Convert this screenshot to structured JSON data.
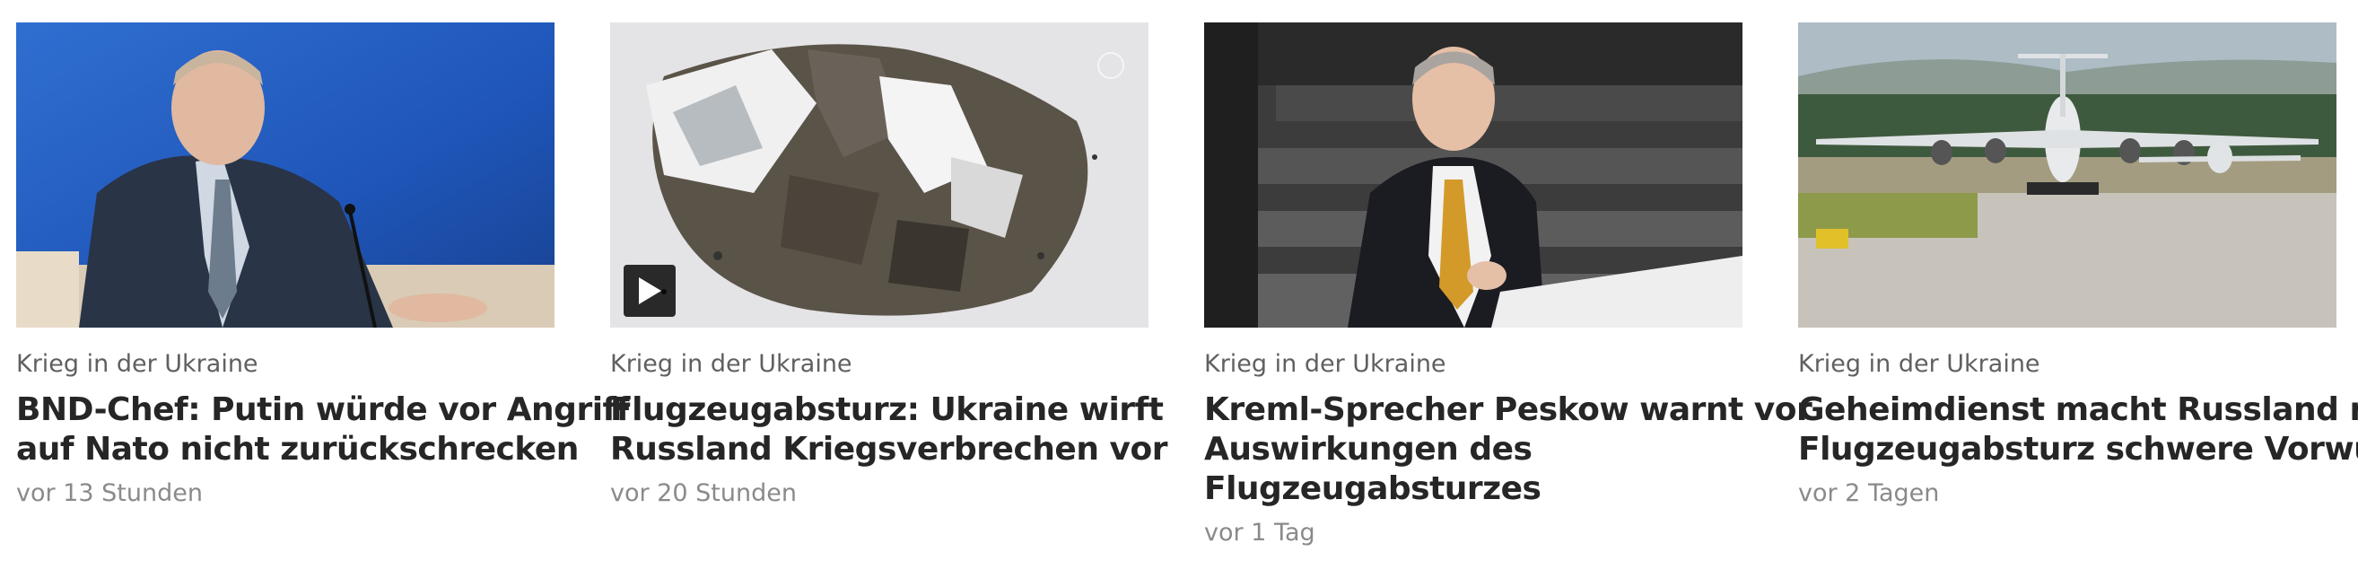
{
  "articles": [
    {
      "kicker": "Krieg in der Ukraine",
      "headline_lines": [
        "BND-Chef: Putin würde vor Angriff",
        "auf Nato nicht zurückschrecken"
      ],
      "timestamp": "vor 13 Stunden",
      "image_icon": "portrait-photo",
      "has_video": false
    },
    {
      "kicker": "Krieg in der Ukraine",
      "headline_lines": [
        "Flugzeugabsturz: Ukraine wirft",
        "Russland Kriegsverbrechen vor"
      ],
      "timestamp": "vor 20 Stunden",
      "image_icon": "wreckage-photo",
      "has_video": true,
      "video_icon": "play-icon"
    },
    {
      "kicker": "Krieg in der Ukraine",
      "headline_lines": [
        "Kreml-Sprecher Peskow warnt vor",
        "Auswirkungen des",
        "Flugzeugabsturzes"
      ],
      "timestamp": "vor 1 Tag",
      "image_icon": "portrait-photo",
      "has_video": false
    },
    {
      "kicker": "Krieg in der Ukraine",
      "headline_lines": [
        "Geheimdienst macht Russland nach",
        "Flugzeugabsturz schwere Vorwürfe"
      ],
      "timestamp": "vor 2 Tagen",
      "image_icon": "aircraft-photo",
      "has_video": false
    }
  ],
  "colors": {
    "kicker": "#606060",
    "headline": "#262626",
    "timestamp": "#8a8a8a",
    "background": "#ffffff"
  }
}
